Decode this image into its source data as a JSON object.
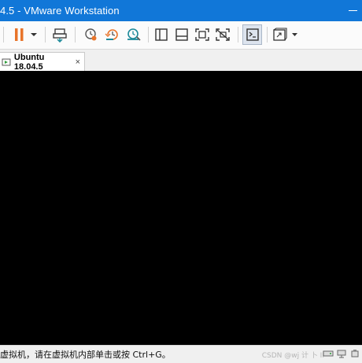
{
  "window": {
    "title": "4.5 - VMware Workstation"
  },
  "toolbar": {
    "buttons": [
      {
        "name": "pause",
        "icon": "pause-icon",
        "color": "#e8742a"
      },
      {
        "name": "send-ctrl-alt-del",
        "icon": "send-keys-icon"
      },
      {
        "name": "take-snapshot",
        "icon": "snapshot-clock-icon"
      },
      {
        "name": "revert-snapshot",
        "icon": "revert-snapshot-icon"
      },
      {
        "name": "snapshot-manager",
        "icon": "snapshot-manager-icon"
      },
      {
        "name": "show-library",
        "icon": "sidebar-icon"
      },
      {
        "name": "thumbnail-bar",
        "icon": "thumbnail-bar-icon"
      },
      {
        "name": "full-screen",
        "icon": "fullscreen-icon"
      },
      {
        "name": "unity",
        "icon": "unity-icon"
      },
      {
        "name": "console-view",
        "icon": "console-view-icon"
      },
      {
        "name": "stretch-guest",
        "icon": "stretch-icon"
      }
    ]
  },
  "tabs": [
    {
      "label": "Ubuntu 18.04.5",
      "icon": "vm-running-icon",
      "close": "×",
      "active": true
    }
  ],
  "statusbar": {
    "text": "虚拟机，请在虚拟机内部单击或按 Ctrl+G。",
    "watermark": "CSDN @wj 计 卜 II"
  },
  "colors": {
    "titlebar": "#1177d8",
    "console": "#000000",
    "accent_orange": "#e8742a",
    "accent_teal": "#1d8a9a"
  }
}
